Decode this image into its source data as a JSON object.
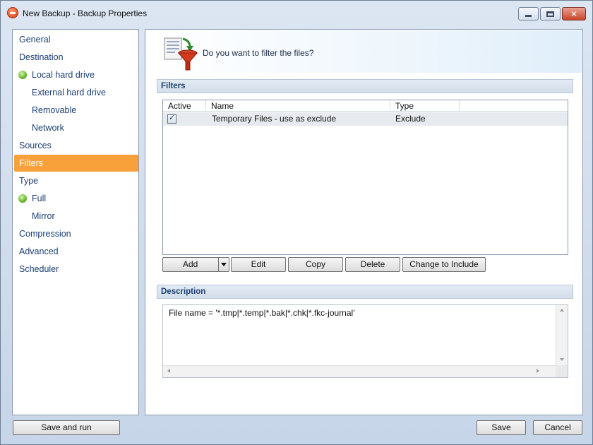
{
  "window": {
    "title": "New Backup - Backup Properties",
    "icon": "app-logo-icon"
  },
  "sidebar": {
    "items": [
      {
        "label": "General"
      },
      {
        "label": "Destination"
      },
      {
        "label": "Local hard drive"
      },
      {
        "label": "External hard drive"
      },
      {
        "label": "Removable"
      },
      {
        "label": "Network"
      },
      {
        "label": "Sources"
      },
      {
        "label": "Filters"
      },
      {
        "label": "Type"
      },
      {
        "label": "Full"
      },
      {
        "label": "Mirror"
      },
      {
        "label": "Compression"
      },
      {
        "label": "Advanced"
      },
      {
        "label": "Scheduler"
      }
    ],
    "selected": "Filters",
    "selected_color": "#f8a13a"
  },
  "main": {
    "question": "Do you want to filter the files?",
    "filters_header": "Filters",
    "grid": {
      "columns": [
        "Active",
        "Name",
        "Type"
      ],
      "rows": [
        {
          "active": true,
          "name": "Temporary Files - use as exclude",
          "type": "Exclude"
        }
      ]
    },
    "buttons": {
      "add": "Add",
      "edit": "Edit",
      "copy": "Copy",
      "delete": "Delete",
      "change": "Change to Include"
    },
    "description_header": "Description",
    "description_text": "File name = '*.tmp|*.temp|*.bak|*.chk|*.fkc-journal'"
  },
  "footer": {
    "save_and_run": "Save and run",
    "save": "Save",
    "cancel": "Cancel"
  }
}
